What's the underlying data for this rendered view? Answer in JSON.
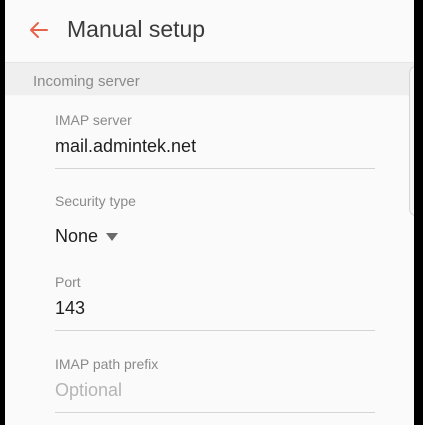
{
  "header": {
    "back_icon": "arrow-left-icon",
    "title": "Manual setup"
  },
  "section": {
    "label": "Incoming server"
  },
  "fields": {
    "imap_server": {
      "label": "IMAP server",
      "value": "mail.admintek.net"
    },
    "security_type": {
      "label": "Security type",
      "value": "None",
      "icon": "caret-down-icon"
    },
    "port": {
      "label": "Port",
      "value": "143"
    },
    "imap_path_prefix": {
      "label": "IMAP path prefix",
      "placeholder": "Optional"
    }
  },
  "colors": {
    "accent": "#e8624a",
    "text_primary": "#1e1e1e",
    "text_secondary": "#8a8a8a",
    "divider": "#d4d4d4"
  }
}
